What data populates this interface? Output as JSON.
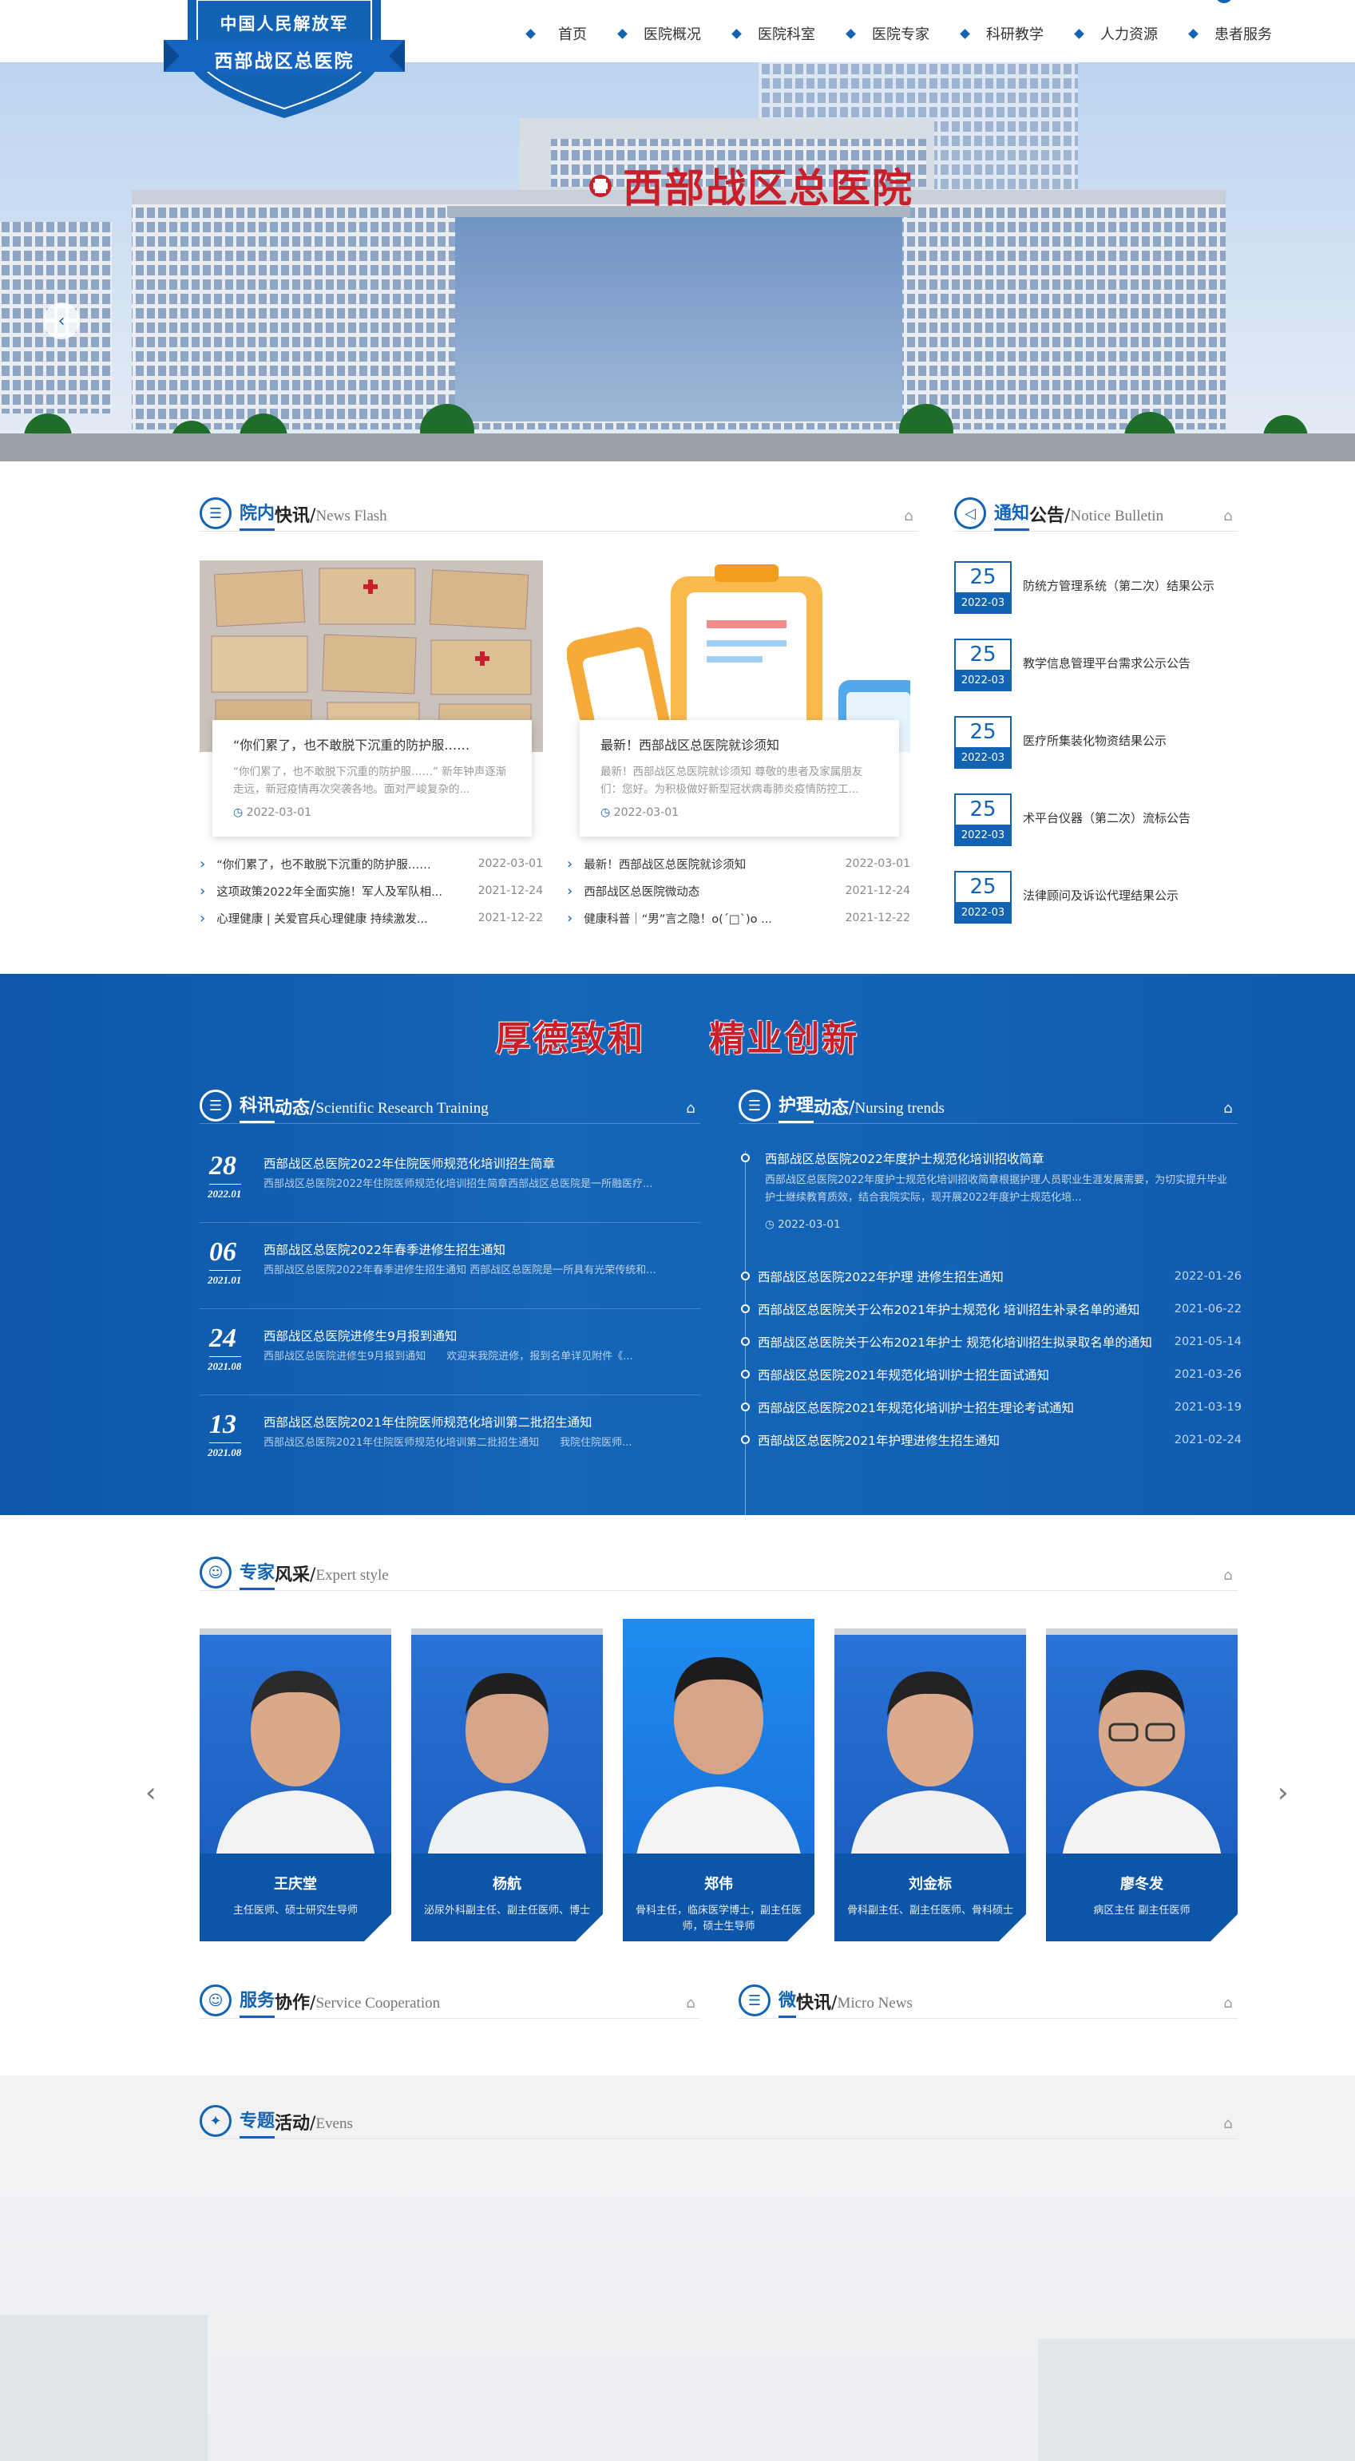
{
  "logo": {
    "top_text": "中国人民解放军",
    "name": "西部战区总医院"
  },
  "nav": [
    {
      "label": "首页"
    },
    {
      "label": "医院概况"
    },
    {
      "label": "医院科室"
    },
    {
      "label": "医院专家"
    },
    {
      "label": "科研教学"
    },
    {
      "label": "人力资源"
    },
    {
      "label": "患者服务"
    }
  ],
  "hero": {
    "sign": "西部战区总医院"
  },
  "news": {
    "title_a": "院内",
    "title_b": "快讯",
    "title_en": "News Flash",
    "cards": [
      {
        "title": "“你们累了，也不敢脱下沉重的防护服……",
        "desc": "“你们累了，也不敢脱下沉重的防护服……” 新年钟声逐渐走远，新冠疫情再次突袭各地。面对严峻复杂的...",
        "date": "2022-03-01"
      },
      {
        "title": "最新！西部战区总医院就诊须知",
        "desc": "最新！西部战区总医院就诊须知 尊敬的患者及家属朋友们：您好。为积极做好新型冠状病毒肺炎疫情防控工...",
        "date": "2022-03-01"
      }
    ],
    "list_left": [
      {
        "text": "“你们累了，也不敢脱下沉重的防护服……",
        "date": "2022-03-01"
      },
      {
        "text": "这项政策2022年全面实施！军人及军队相...",
        "date": "2021-12-24"
      },
      {
        "text": "心理健康 | 关爱官兵心理健康 持续激发...",
        "date": "2021-12-22"
      }
    ],
    "list_right": [
      {
        "text": "最新！西部战区总医院就诊须知",
        "date": "2022-03-01"
      },
      {
        "text": "西部战区总医院微动态",
        "date": "2021-12-24"
      },
      {
        "text": "健康科普｜“男”言之隐！o(´□`)o ...",
        "date": "2021-12-22"
      }
    ]
  },
  "notice": {
    "title_a": "通知",
    "title_b": "公告",
    "title_en": "Notice Bulletin",
    "items": [
      {
        "day": "25",
        "ym": "2022-03",
        "text": "防统方管理系统（第二次）结果公示"
      },
      {
        "day": "25",
        "ym": "2022-03",
        "text": "教学信息管理平台需求公示公告"
      },
      {
        "day": "25",
        "ym": "2022-03",
        "text": "医疗所集装化物资结果公示"
      },
      {
        "day": "25",
        "ym": "2022-03",
        "text": "术平台仪器（第二次）流标公告"
      },
      {
        "day": "25",
        "ym": "2022-03",
        "text": "法律顾问及诉讼代理结果公示"
      }
    ]
  },
  "motto": {
    "left": "厚德致和",
    "right": "精业创新"
  },
  "research": {
    "title_a": "科讯",
    "title_b": "动态",
    "title_en": "Scientific Research Training",
    "items": [
      {
        "day": "28",
        "ym": "2022.01",
        "title": "西部战区总医院2022年住院医师规范化培训招生简章",
        "desc": "西部战区总医院2022年住院医师规范化培训招生简章西部战区总医院是一所融医疗..."
      },
      {
        "day": "06",
        "ym": "2021.01",
        "title": "西部战区总医院2022年春季进修生招生通知",
        "desc": "西部战区总医院2022年春季进修生招生通知 西部战区总医院是一所具有光荣传统和..."
      },
      {
        "day": "24",
        "ym": "2021.08",
        "title": "西部战区总医院进修生9月报到通知",
        "desc": "西部战区总医院进修生9月报到通知　　欢迎来我院进修，报到名单详见附件《..."
      },
      {
        "day": "13",
        "ym": "2021.08",
        "title": "西部战区总医院2021年住院医师规范化培训第二批招生通知",
        "desc": "西部战区总医院2021年住院医师规范化培训第二批招生通知　　我院住院医师..."
      }
    ]
  },
  "nursing": {
    "title_a": "护理",
    "title_b": "动态",
    "title_en": "Nursing trends",
    "featured": {
      "title": "西部战区总医院2022年度护士规范化培训招收简章",
      "desc": "西部战区总医院2022年度护士规范化培训招收简章根据护理人员职业生涯发展需要，为切实提升毕业护士继续教育质效，结合我院实际，现开展2022年度护士规范化培...",
      "date": "2022-03-01"
    },
    "items": [
      {
        "text": "西部战区总医院2022年护理 进修生招生通知",
        "date": "2022-01-26"
      },
      {
        "text": "西部战区总医院关于公布2021年护士规范化 培训招生补录名单的通知",
        "date": "2021-06-22"
      },
      {
        "text": "西部战区总医院关于公布2021年护士 规范化培训招生拟录取名单的通知",
        "date": "2021-05-14"
      },
      {
        "text": "西部战区总医院2021年规范化培训护士招生面试通知",
        "date": "2021-03-26"
      },
      {
        "text": "西部战区总医院2021年规范化培训护士招生理论考试通知",
        "date": "2021-03-19"
      },
      {
        "text": "西部战区总医院2021年护理进修生招生通知",
        "date": "2021-02-24"
      }
    ]
  },
  "experts": {
    "title_a": "专家",
    "title_b": "风采",
    "title_en": "Expert style",
    "items": [
      {
        "name": "王庆堂",
        "post": "主任医师、硕士研究生导师"
      },
      {
        "name": "杨航",
        "post": "泌尿外科副主任、副主任医师、博士"
      },
      {
        "name": "郑伟",
        "post": "骨科主任，临床医学博士，副主任医师，硕士生导师"
      },
      {
        "name": "刘金标",
        "post": "骨科副主任、副主任医师、骨科硕士"
      },
      {
        "name": "廖冬发",
        "post": "病区主任 副主任医师"
      }
    ]
  },
  "service": {
    "title_a": "服务",
    "title_b": "协作",
    "title_en": "Service Cooperation"
  },
  "micro": {
    "title_a": "微",
    "title_b": "快讯",
    "title_en": "Micro News"
  },
  "events": {
    "title_a": "专题",
    "title_b": "活动",
    "title_en": "Evens"
  },
  "colors": {
    "primary": "#1263b4",
    "band": "#1262b6",
    "motto": "#c8202a"
  }
}
